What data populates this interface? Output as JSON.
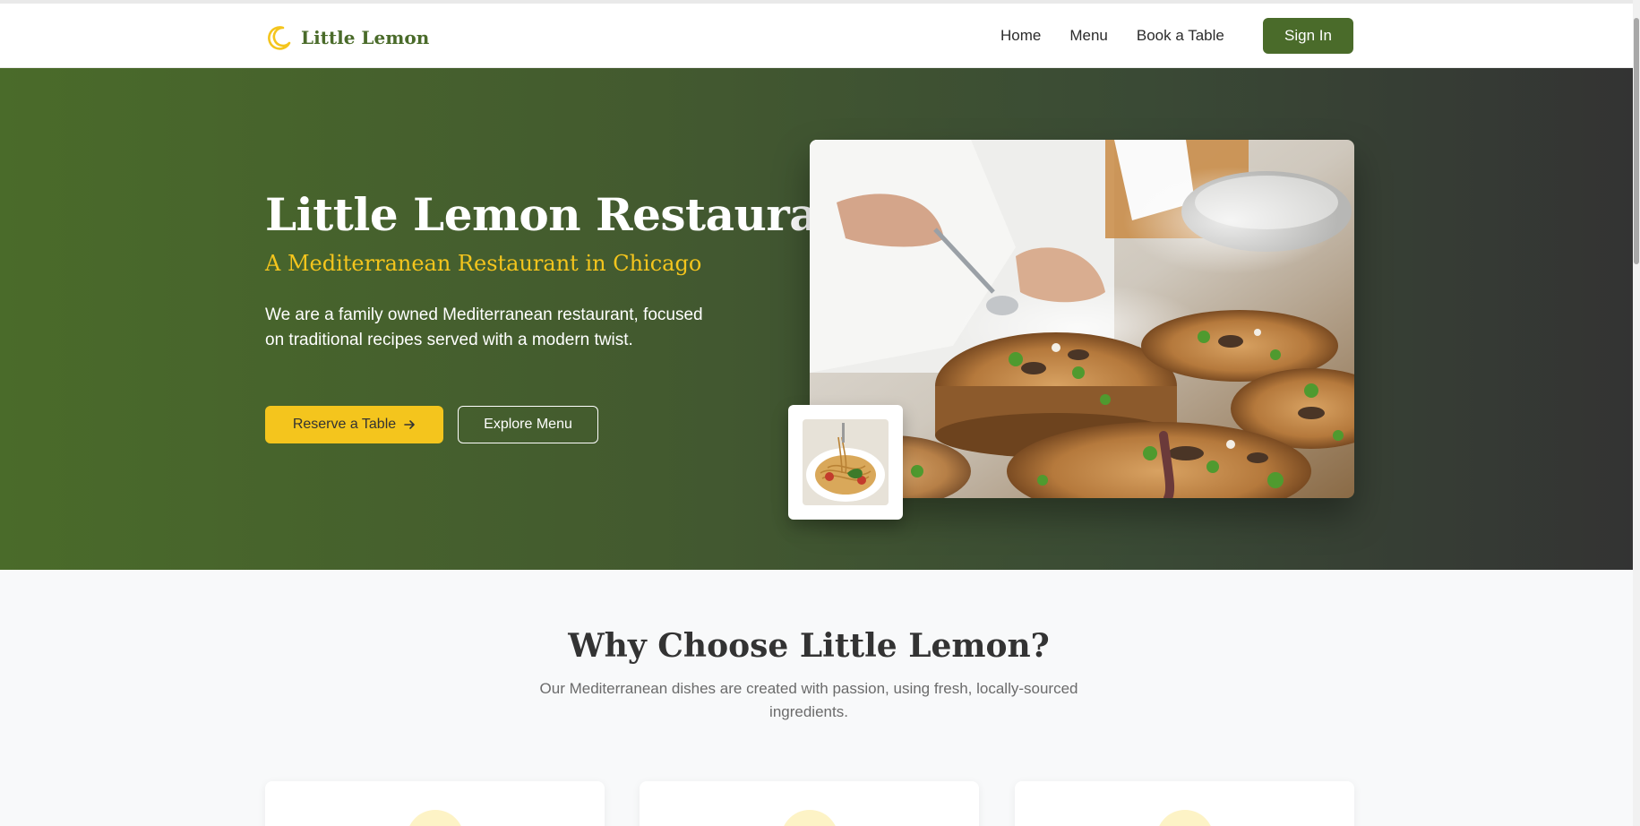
{
  "brand": {
    "name": "Little Lemon",
    "logo_icon": "crescent-moon-icon",
    "color": "#4a6b2a",
    "accent": "#f4c51d"
  },
  "nav": {
    "links": [
      "Home",
      "Menu",
      "Book a Table"
    ],
    "signin_label": "Sign In"
  },
  "hero": {
    "title": "Little Lemon Restaurant",
    "subtitle": "A Mediterranean Restaurant in Chicago",
    "description": "We are a family owned Mediterranean restaurant, focused on traditional recipes served with a modern twist.",
    "reserve_label": "Reserve a Table",
    "reserve_icon": "arrow-right-icon",
    "explore_label": "Explore Menu"
  },
  "features": {
    "title": "Why Choose Little Lemon?",
    "description": "Our Mediterranean dishes are created with passion, using fresh, locally-sourced ingredients."
  }
}
